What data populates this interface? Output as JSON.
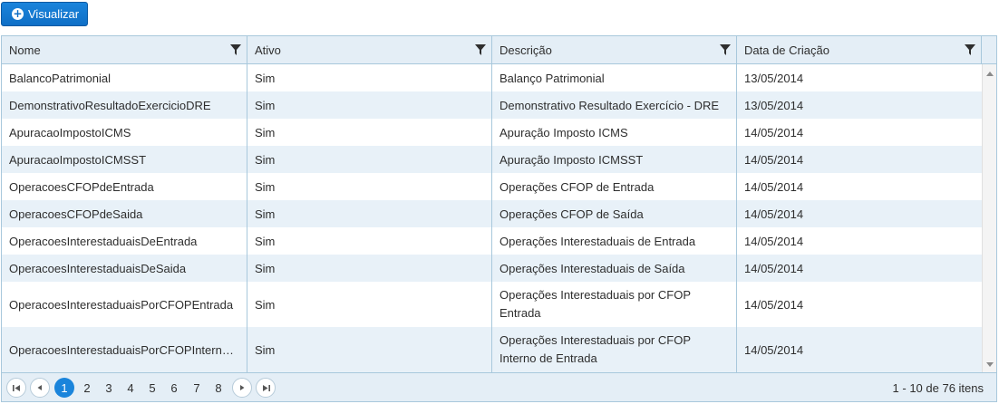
{
  "toolbar": {
    "visualizar_label": "Visualizar"
  },
  "columns": [
    {
      "label": "Nome"
    },
    {
      "label": "Ativo"
    },
    {
      "label": "Descrição"
    },
    {
      "label": "Data de Criação"
    }
  ],
  "rows": [
    {
      "nome": "BalancoPatrimonial",
      "ativo": "Sim",
      "descricao": "Balanço Patrimonial",
      "data": "13/05/2014"
    },
    {
      "nome": "DemonstrativoResultadoExercicioDRE",
      "ativo": "Sim",
      "descricao": "Demonstrativo Resultado Exercício - DRE",
      "data": "13/05/2014"
    },
    {
      "nome": "ApuracaoImpostoICMS",
      "ativo": "Sim",
      "descricao": "Apuração Imposto ICMS",
      "data": "14/05/2014"
    },
    {
      "nome": "ApuracaoImpostoICMSST",
      "ativo": "Sim",
      "descricao": "Apuração Imposto ICMSST",
      "data": "14/05/2014"
    },
    {
      "nome": "OperacoesCFOPdeEntrada",
      "ativo": "Sim",
      "descricao": "Operações CFOP de Entrada",
      "data": "14/05/2014"
    },
    {
      "nome": "OperacoesCFOPdeSaida",
      "ativo": "Sim",
      "descricao": "Operações CFOP de Saída",
      "data": "14/05/2014"
    },
    {
      "nome": "OperacoesInterestaduaisDeEntrada",
      "ativo": "Sim",
      "descricao": "Operações Interestaduais de Entrada",
      "data": "14/05/2014"
    },
    {
      "nome": "OperacoesInterestaduaisDeSaida",
      "ativo": "Sim",
      "descricao": "Operações Interestaduais de Saída",
      "data": "14/05/2014"
    },
    {
      "nome": "OperacoesInterestaduaisPorCFOPEntrada",
      "ativo": "Sim",
      "descricao": "Operações Interestaduais por CFOP Entrada",
      "data": "14/05/2014"
    },
    {
      "nome": "OperacoesInterestaduaisPorCFOPInterno…",
      "ativo": "Sim",
      "descricao": "Operações Interestaduais por CFOP Interno de Entrada",
      "data": "14/05/2014"
    }
  ],
  "pager": {
    "pages": [
      "1",
      "2",
      "3",
      "4",
      "5",
      "6",
      "7",
      "8"
    ],
    "current": "1",
    "info": "1 - 10 de 76 itens"
  },
  "colors": {
    "accent": "#1a84db",
    "header_bg": "#e4eef6",
    "alt_row_bg": "#e8f1f8",
    "border": "#a8c8dc"
  }
}
